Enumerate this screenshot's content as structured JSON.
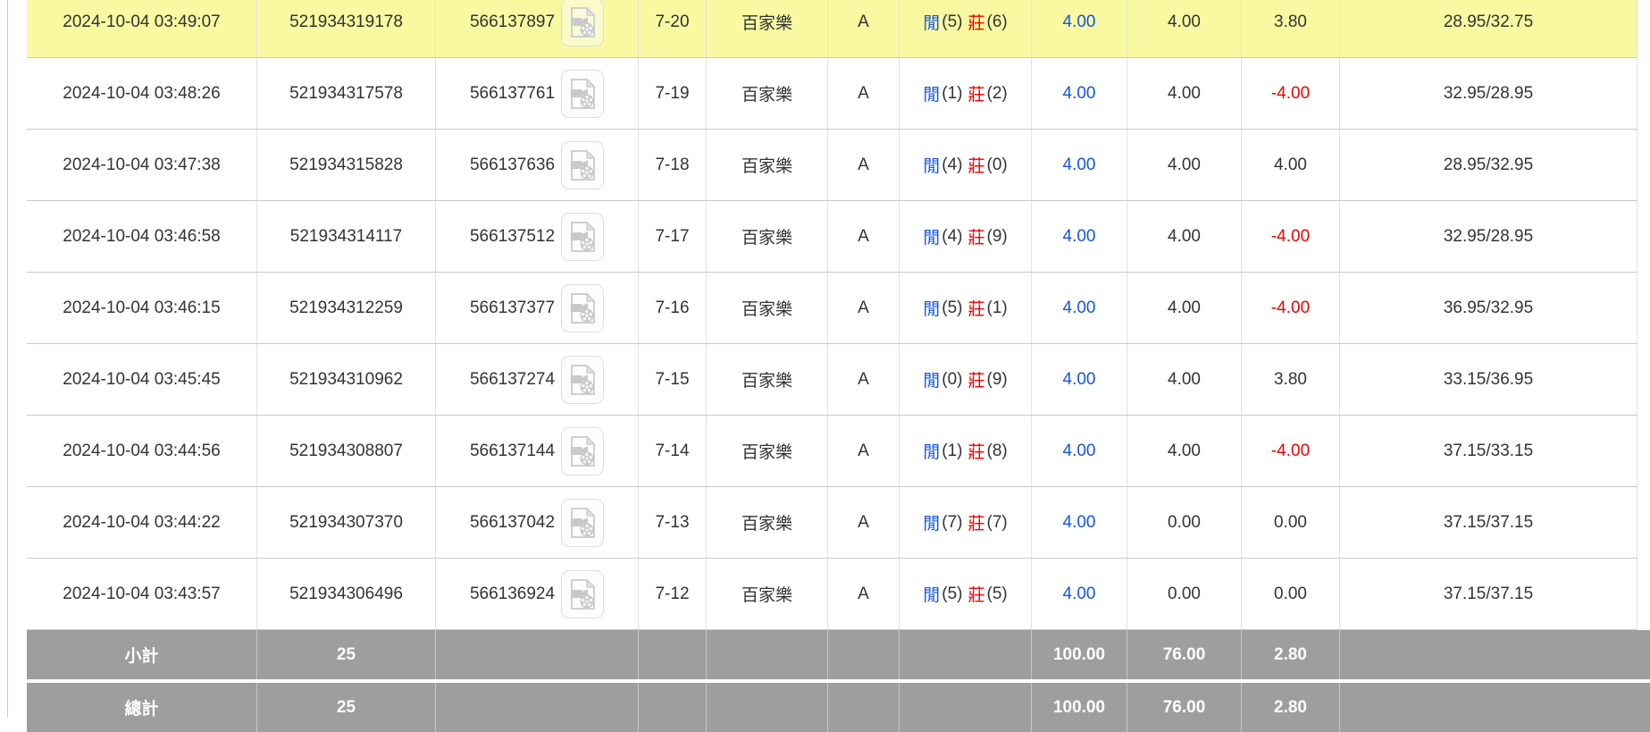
{
  "colors": {
    "highlight_yellow": "#f9f9a2",
    "link_blue": "#1355e8",
    "player_blue": "#1355e8",
    "banker_red": "#f00000",
    "negative_red": "#f00000",
    "summary_gray": "#9e9e9e",
    "row_border": "#c9c9c9"
  },
  "icons": {
    "video_replay": "video-file-icon"
  },
  "table": {
    "rows": [
      {
        "time": "2024-10-04 03:49:07",
        "bet_id": "521934319178",
        "game_id": "566137897",
        "round": "7-20",
        "game_type": "百家樂",
        "table_code": "A",
        "player": "閒",
        "player_n": "(5)",
        "banker": "莊",
        "banker_n": "(6)",
        "bet_amount": "4.00",
        "valid_amount": "4.00",
        "win_loss": "3.80",
        "balance": "28.95/32.75",
        "highlighted": true
      },
      {
        "time": "2024-10-04 03:48:26",
        "bet_id": "521934317578",
        "game_id": "566137761",
        "round": "7-19",
        "game_type": "百家樂",
        "table_code": "A",
        "player": "閒",
        "player_n": "(1)",
        "banker": "莊",
        "banker_n": "(2)",
        "bet_amount": "4.00",
        "valid_amount": "4.00",
        "win_loss": "-4.00",
        "balance": "32.95/28.95",
        "highlighted": false
      },
      {
        "time": "2024-10-04 03:47:38",
        "bet_id": "521934315828",
        "game_id": "566137636",
        "round": "7-18",
        "game_type": "百家樂",
        "table_code": "A",
        "player": "閒",
        "player_n": "(4)",
        "banker": "莊",
        "banker_n": "(0)",
        "bet_amount": "4.00",
        "valid_amount": "4.00",
        "win_loss": "4.00",
        "balance": "28.95/32.95",
        "highlighted": false
      },
      {
        "time": "2024-10-04 03:46:58",
        "bet_id": "521934314117",
        "game_id": "566137512",
        "round": "7-17",
        "game_type": "百家樂",
        "table_code": "A",
        "player": "閒",
        "player_n": "(4)",
        "banker": "莊",
        "banker_n": "(9)",
        "bet_amount": "4.00",
        "valid_amount": "4.00",
        "win_loss": "-4.00",
        "balance": "32.95/28.95",
        "highlighted": false
      },
      {
        "time": "2024-10-04 03:46:15",
        "bet_id": "521934312259",
        "game_id": "566137377",
        "round": "7-16",
        "game_type": "百家樂",
        "table_code": "A",
        "player": "閒",
        "player_n": "(5)",
        "banker": "莊",
        "banker_n": "(1)",
        "bet_amount": "4.00",
        "valid_amount": "4.00",
        "win_loss": "-4.00",
        "balance": "36.95/32.95",
        "highlighted": false
      },
      {
        "time": "2024-10-04 03:45:45",
        "bet_id": "521934310962",
        "game_id": "566137274",
        "round": "7-15",
        "game_type": "百家樂",
        "table_code": "A",
        "player": "閒",
        "player_n": "(0)",
        "banker": "莊",
        "banker_n": "(9)",
        "bet_amount": "4.00",
        "valid_amount": "4.00",
        "win_loss": "3.80",
        "balance": "33.15/36.95",
        "highlighted": false
      },
      {
        "time": "2024-10-04 03:44:56",
        "bet_id": "521934308807",
        "game_id": "566137144",
        "round": "7-14",
        "game_type": "百家樂",
        "table_code": "A",
        "player": "閒",
        "player_n": "(1)",
        "banker": "莊",
        "banker_n": "(8)",
        "bet_amount": "4.00",
        "valid_amount": "4.00",
        "win_loss": "-4.00",
        "balance": "37.15/33.15",
        "highlighted": false
      },
      {
        "time": "2024-10-04 03:44:22",
        "bet_id": "521934307370",
        "game_id": "566137042",
        "round": "7-13",
        "game_type": "百家樂",
        "table_code": "A",
        "player": "閒",
        "player_n": "(7)",
        "banker": "莊",
        "banker_n": "(7)",
        "bet_amount": "4.00",
        "valid_amount": "0.00",
        "win_loss": "0.00",
        "balance": "37.15/37.15",
        "highlighted": false
      },
      {
        "time": "2024-10-04 03:43:57",
        "bet_id": "521934306496",
        "game_id": "566136924",
        "round": "7-12",
        "game_type": "百家樂",
        "table_code": "A",
        "player": "閒",
        "player_n": "(5)",
        "banker": "莊",
        "banker_n": "(5)",
        "bet_amount": "4.00",
        "valid_amount": "0.00",
        "win_loss": "0.00",
        "balance": "37.15/37.15",
        "highlighted": false
      }
    ],
    "summary_rows": [
      {
        "label": "小計",
        "count": "25",
        "bet_total": "100.00",
        "valid_total": "76.00",
        "win_total": "2.80"
      },
      {
        "label": "總計",
        "count": "25",
        "bet_total": "100.00",
        "valid_total": "76.00",
        "win_total": "2.80"
      }
    ]
  }
}
